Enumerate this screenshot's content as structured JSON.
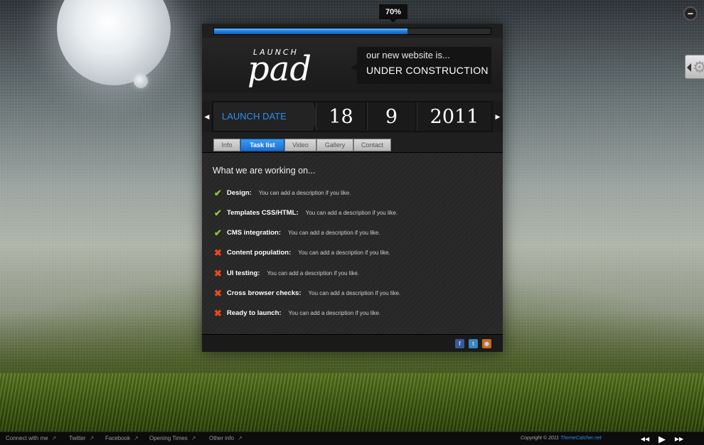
{
  "progress": {
    "label": "70%",
    "percent": 70
  },
  "brand": {
    "logo_top": "LAUNCH",
    "logo_main": "pad",
    "tagline_line1": "our new website is...",
    "tagline_line2": "UNDER CONSTRUCTION"
  },
  "launch": {
    "label": "LAUNCH DATE",
    "day": "18",
    "month": "9",
    "year": "2011",
    "prev_icon": "triangle-left-icon",
    "next_icon": "triangle-right-icon"
  },
  "tabs": [
    {
      "label": "Info",
      "active": false
    },
    {
      "label": "Task list",
      "active": true
    },
    {
      "label": "Video",
      "active": false
    },
    {
      "label": "Gallery",
      "active": false
    },
    {
      "label": "Contact",
      "active": false
    }
  ],
  "tasklist": {
    "heading": "What we are working on...",
    "items": [
      {
        "name": "Design:",
        "desc": "You can add a description if you like.",
        "done": true
      },
      {
        "name": "Templates CSS/HTML:",
        "desc": "You can add a description if you like.",
        "done": true
      },
      {
        "name": "CMS integration:",
        "desc": "You can add a description if you like.",
        "done": true
      },
      {
        "name": "Content population:",
        "desc": "You can add a description if you like.",
        "done": false
      },
      {
        "name": "UI testing:",
        "desc": "You can add a description if you like.",
        "done": false
      },
      {
        "name": "Cross browser checks:",
        "desc": "You can add a description if you like.",
        "done": false
      },
      {
        "name": "Ready to launch:",
        "desc": "You can add a description if you like.",
        "done": false
      }
    ]
  },
  "social": [
    {
      "icon": "facebook-icon",
      "glyph": "f",
      "color": "#3b5998"
    },
    {
      "icon": "twitter-icon",
      "glyph": "t",
      "color": "#3a86c4"
    },
    {
      "icon": "rss-icon",
      "glyph": "◉",
      "color": "#c96a1e"
    }
  ],
  "footer": {
    "links": [
      {
        "label": "Connect with me",
        "ext": "↗"
      },
      {
        "label": "Twitter",
        "ext": "↗"
      },
      {
        "label": "Facebook",
        "ext": "↗"
      },
      {
        "label": "Opening Times",
        "ext": "↗"
      },
      {
        "label": "Other info",
        "ext": "↗"
      }
    ],
    "copyright_prefix": "Copyright © 2011",
    "copyright_brand": "ThemeCatcher.net",
    "controls": {
      "rewind": "◀◀",
      "play": "▶",
      "forward": "▶▶"
    }
  },
  "window": {
    "minimize": "−",
    "settings_icon": "gear-icon",
    "settings_glyph": "⚙"
  }
}
